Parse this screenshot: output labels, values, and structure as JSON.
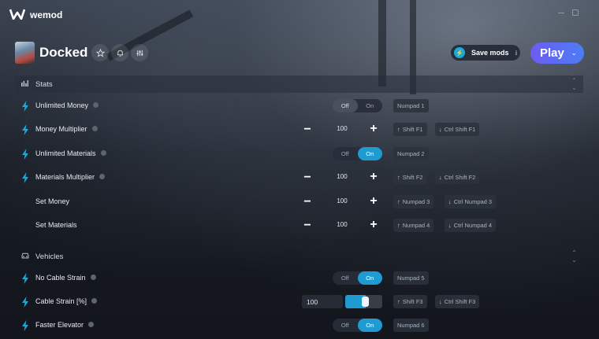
{
  "app": {
    "name": "wemod"
  },
  "header": {
    "game_title": "Docked",
    "save_mods_label": "Save mods",
    "play_label": "Play"
  },
  "sections": {
    "stats": "Stats",
    "vehicles": "Vehicles"
  },
  "rows": [
    {
      "label": "Unlimited Money",
      "control": "toggle",
      "state": "Off",
      "keys": [
        "Numpad 1"
      ]
    },
    {
      "label": "Money Multiplier",
      "control": "stepper",
      "value": "100",
      "keys": [
        "Shift F1",
        "Ctrl Shift F1"
      ]
    },
    {
      "label": "Unlimited Materials",
      "control": "toggle",
      "state": "On",
      "keys": [
        "Numpad 2"
      ]
    },
    {
      "label": "Materials Multiplier",
      "control": "stepper",
      "value": "100",
      "keys": [
        "Shift F2",
        "Ctrl Shift F2"
      ]
    },
    {
      "label": "Set Money",
      "control": "stepper",
      "value": "100",
      "keys": [
        "Numpad 3",
        "Ctrl Numpad 3"
      ]
    },
    {
      "label": "Set Materials",
      "control": "stepper",
      "value": "100",
      "keys": [
        "Numpad 4",
        "Ctrl Numpad 4"
      ]
    },
    {
      "label": "No Cable Strain",
      "control": "toggle",
      "state": "On",
      "keys": [
        "Numpad 5"
      ]
    },
    {
      "label": "Cable Strain [%]",
      "control": "slider",
      "value": "100",
      "fraction": 0.55,
      "keys": [
        "Shift F3",
        "Ctrl Shift F3"
      ]
    },
    {
      "label": "Faster Elevator",
      "control": "toggle",
      "state": "On",
      "keys": [
        "Numpad 6"
      ]
    }
  ],
  "toggle_labels": {
    "off": "Off",
    "on": "On"
  },
  "colors": {
    "accent": "#1f9bd1",
    "play_start": "#6c5cf2",
    "play_end": "#4d7df5",
    "bolt": "#1aa9d8"
  }
}
